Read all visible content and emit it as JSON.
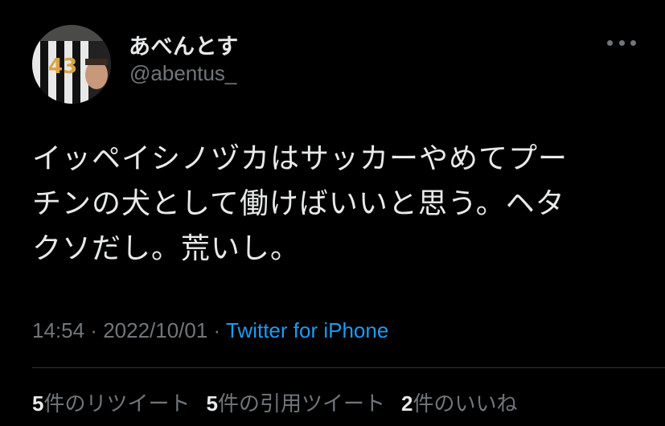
{
  "user": {
    "display_name": "あべんとす",
    "handle": "@abentus_",
    "avatar_icon": "user-avatar"
  },
  "more_icon": "more-options-icon",
  "tweet": {
    "text": "イッペイシノヅカはサッカーやめてプー\nチンの犬として働けばいいと思う。ヘタ\nクソだし。荒いし。"
  },
  "meta": {
    "time": "14:54",
    "separator1": " · ",
    "date": "2022/10/01",
    "separator2": " · ",
    "source": "Twitter for iPhone"
  },
  "stats": {
    "retweets_count": "5",
    "retweets_label": "件のリツイート",
    "quotes_count": "5",
    "quotes_label": "件の引用ツイート",
    "likes_count": "2",
    "likes_label": "件のいいね"
  },
  "colors": {
    "background": "#000000",
    "text_primary": "#e7e9ea",
    "text_secondary": "#71767b",
    "link": "#1d9bf0",
    "divider": "#2f3336"
  }
}
